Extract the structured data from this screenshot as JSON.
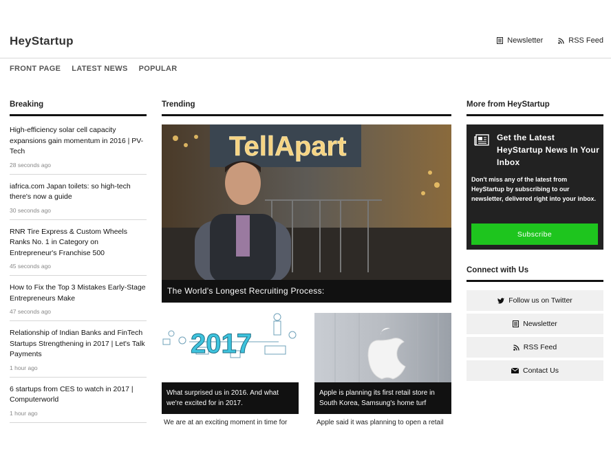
{
  "header": {
    "brand": "HeyStartup",
    "links": [
      {
        "label": "Newsletter",
        "icon": "newsletter-icon"
      },
      {
        "label": "RSS Feed",
        "icon": "rss-icon"
      }
    ]
  },
  "nav": [
    "FRONT PAGE",
    "LATEST NEWS",
    "POPULAR"
  ],
  "breaking": {
    "heading": "Breaking",
    "items": [
      {
        "title": "High-efficiency solar cell capacity expansions gain momentum in 2016 | PV-Tech",
        "time": "28 seconds ago"
      },
      {
        "title": "iafrica.com Japan toilets: so high-tech there's now a guide",
        "time": "30 seconds ago"
      },
      {
        "title": "RNR Tire Express & Custom Wheels Ranks No. 1 in Category on Entrepreneur's Franchise 500",
        "time": "45 seconds ago"
      },
      {
        "title": "How to Fix the Top 3 Mistakes Early-Stage Entrepreneurs Make",
        "time": "47 seconds ago"
      },
      {
        "title": "Relationship of Indian Banks and FinTech Startups Strengthening in 2017 | Let's Talk Payments",
        "time": "1 hour ago"
      },
      {
        "title": "6 startups from CES to watch in 2017 | Computerworld",
        "time": "1 hour ago"
      }
    ]
  },
  "trending": {
    "heading": "Trending",
    "hero": {
      "caption": "The World's Longest Recruiting Process:",
      "sign_text": "TellApart"
    },
    "cards": [
      {
        "caption": "What surprised us in 2016. And what we're excited for in 2017.",
        "excerpt": "We are at an exciting moment in time for",
        "image_text": "2017"
      },
      {
        "caption": "Apple is planning its first retail store in South Korea, Samsung's home turf",
        "excerpt": "Apple said it was planning to open a retail",
        "image_text": ""
      }
    ]
  },
  "more": {
    "heading": "More from HeyStartup",
    "promo_title": "Get the Latest HeyStartup News In Your Inbox",
    "promo_text": "Don't miss any of the latest from HeyStartup by subscribing to our newsletter, delivered right into your inbox.",
    "subscribe_label": "Subscribe",
    "accent": "#1ec51e"
  },
  "connect": {
    "heading": "Connect with Us",
    "buttons": [
      {
        "label": "Follow us on Twitter",
        "icon": "twitter-icon"
      },
      {
        "label": "Newsletter",
        "icon": "newsletter-icon"
      },
      {
        "label": "RSS Feed",
        "icon": "rss-icon"
      },
      {
        "label": "Contact Us",
        "icon": "envelope-icon"
      }
    ]
  }
}
